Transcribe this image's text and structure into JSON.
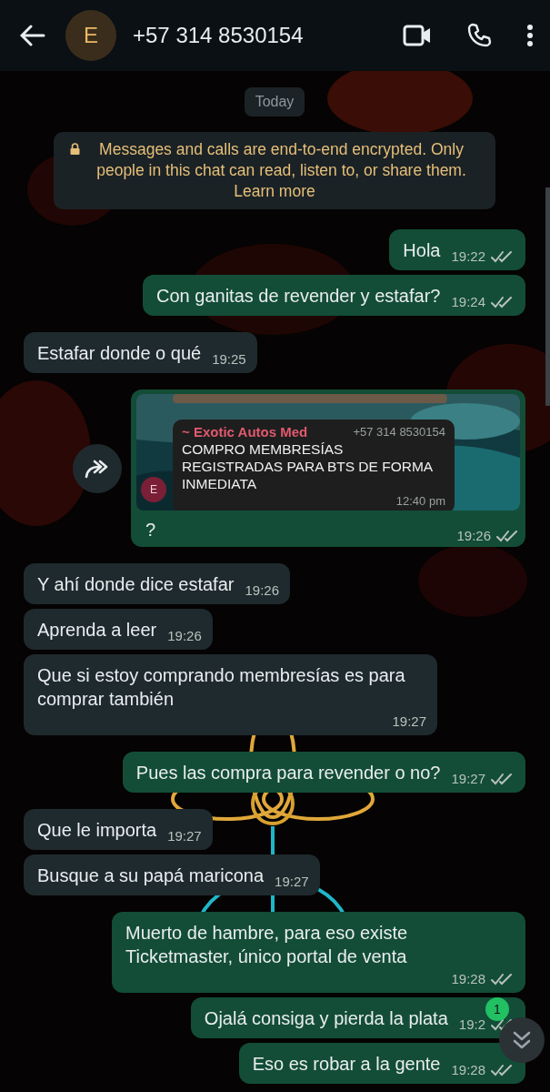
{
  "header": {
    "avatar_letter": "E",
    "title": "+57 314 8530154"
  },
  "date_chip": "Today",
  "encryption_notice": {
    "text": "Messages and calls are end-to-end encrypted. Only people in this chat can read, listen to, or share them.",
    "link": "Learn more"
  },
  "messages": [
    {
      "kind": "text",
      "outgoing": true,
      "text": "Hola",
      "time": "19:22",
      "read": false
    },
    {
      "kind": "text",
      "outgoing": true,
      "text": "Con ganitas de revender y estafar?",
      "time": "19:24",
      "read": false
    },
    {
      "kind": "text",
      "outgoing": false,
      "text": "Estafar donde o qué",
      "time": "19:25"
    },
    {
      "kind": "image_quote",
      "outgoing": true,
      "text": "?",
      "time": "19:26",
      "read": false,
      "quoted": {
        "sender": "~ Exotic Autos Med",
        "phone": "+57 314 8530154",
        "text": "COMPRO MEMBRESÍAS REGISTRADAS PARA BTS DE FORMA INMEDIATA",
        "time": "12:40 pm",
        "avatar_letter": "E"
      }
    },
    {
      "kind": "text",
      "outgoing": false,
      "text": "Y ahí donde dice estafar",
      "time": "19:26"
    },
    {
      "kind": "text",
      "outgoing": false,
      "text": "Aprenda a leer",
      "time": "19:26"
    },
    {
      "kind": "text",
      "outgoing": false,
      "text": "Que si estoy comprando membresías es para comprar también",
      "time": "19:27"
    },
    {
      "kind": "text",
      "outgoing": true,
      "text": "Pues las compra para revender o no?",
      "time": "19:27",
      "read": false
    },
    {
      "kind": "text",
      "outgoing": false,
      "text": "Que le importa",
      "time": "19:27"
    },
    {
      "kind": "text",
      "outgoing": false,
      "text": "Busque a su papá maricona",
      "time": "19:27"
    },
    {
      "kind": "text",
      "outgoing": true,
      "text": "Muerto de hambre, para eso existe Ticketmaster, único portal de venta",
      "time": "19:28",
      "read": false
    },
    {
      "kind": "text",
      "outgoing": true,
      "text": "Ojalá consiga y pierda la plata",
      "time": "19:2",
      "read": false
    },
    {
      "kind": "text",
      "outgoing": true,
      "text": "Eso es robar a la gente",
      "time": "19:28",
      "read": false
    }
  ],
  "scroll_down": {
    "unread_count": "1"
  }
}
